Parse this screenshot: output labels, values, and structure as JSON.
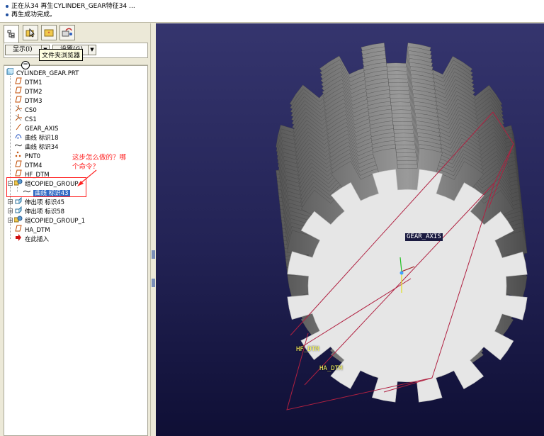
{
  "messages": [
    "正在从34 再生CYLINDER_GEAR特征34 ...",
    "再生成功完成。"
  ],
  "tabs": [
    {
      "name": "model-tree",
      "icon": "tree-icon"
    },
    {
      "name": "folder-browser",
      "icon": "folder-browser-icon"
    },
    {
      "name": "favorites",
      "icon": "favorites-icon"
    },
    {
      "name": "connections",
      "icon": "connections-icon"
    }
  ],
  "tooltip": "文件夹浏览器",
  "toolbar": {
    "show_label": "显示(I)",
    "settings_label": "设置(G)"
  },
  "tree": {
    "root": "CYLINDER_GEAR.PRT",
    "items": [
      {
        "label": "DTM1",
        "icon": "datum-plane-icon"
      },
      {
        "label": "DTM2",
        "icon": "datum-plane-icon"
      },
      {
        "label": "DTM3",
        "icon": "datum-plane-icon"
      },
      {
        "label": "CS0",
        "icon": "coordinate-system-icon"
      },
      {
        "label": "CS1",
        "icon": "coordinate-system-icon"
      },
      {
        "label": "GEAR_AXIS",
        "icon": "datum-axis-icon"
      },
      {
        "label": "曲线 标识18",
        "icon": "curve-equation-icon"
      },
      {
        "label": "曲线 标识34",
        "icon": "curve-icon"
      },
      {
        "label": "PNT0",
        "icon": "datum-point-icon"
      },
      {
        "label": "DTM4",
        "icon": "datum-plane-icon"
      },
      {
        "label": "HF_DTM",
        "icon": "datum-plane-icon"
      },
      {
        "label": "组COPIED_GROUP",
        "icon": "group-icon"
      },
      {
        "label": "曲线 标识43",
        "icon": "curve-icon"
      },
      {
        "label": "伸出项 标识45",
        "icon": "extrude-icon"
      },
      {
        "label": "伸出项 标识58",
        "icon": "extrude-icon"
      },
      {
        "label": "组COPIED_GROUP_1",
        "icon": "group-icon"
      },
      {
        "label": "HA_DTM",
        "icon": "datum-plane-icon"
      },
      {
        "label": "在此插入",
        "icon": "insert-here-icon"
      }
    ]
  },
  "annotation": {
    "line1": "这步怎么做的？哪",
    "line2": "个命令？"
  },
  "viewport": {
    "labels": {
      "gear_axis": "GEAR_AXIS",
      "hf_dtm": "HF_DTM",
      "ha_dtm": "HA_DTM"
    },
    "colors": {
      "background": "#222254",
      "gear_face": "#e6e6e6",
      "gear_side": "#7a7a7a",
      "curve": "#b02040",
      "annotation": "#ff2020"
    },
    "gear_teeth": 16
  }
}
